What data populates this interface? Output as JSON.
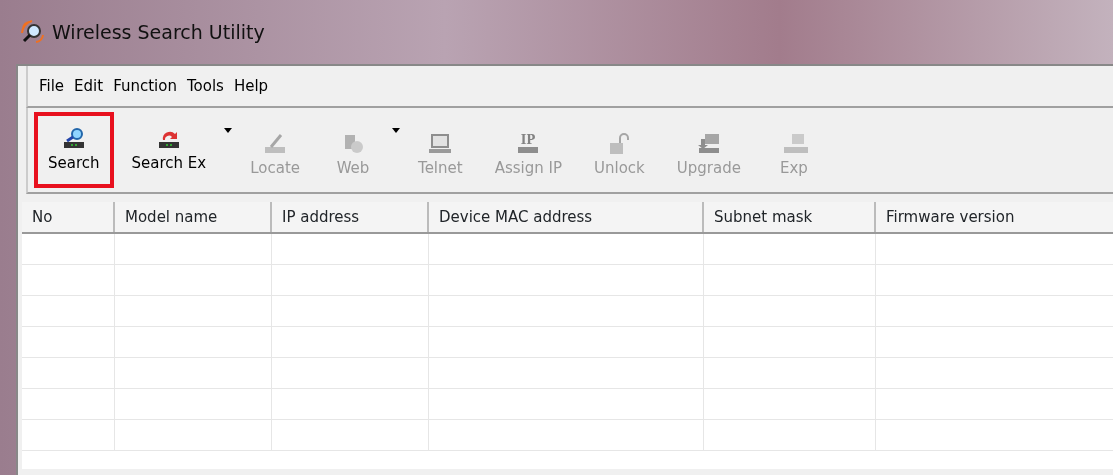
{
  "window": {
    "title": "Wireless Search Utility"
  },
  "menu": [
    "File",
    "Edit",
    "Function",
    "Tools",
    "Help"
  ],
  "toolbar": [
    {
      "label": "Search",
      "disabled": false,
      "dropdown": false,
      "highlighted": true,
      "kind": "search"
    },
    {
      "label": "Search Ex",
      "disabled": false,
      "dropdown": true,
      "highlighted": false,
      "kind": "search-ex"
    },
    {
      "label": "Locate",
      "disabled": true,
      "dropdown": false,
      "highlighted": false,
      "kind": "locate"
    },
    {
      "label": "Web",
      "disabled": true,
      "dropdown": true,
      "highlighted": false,
      "kind": "web"
    },
    {
      "label": "Telnet",
      "disabled": true,
      "dropdown": false,
      "highlighted": false,
      "kind": "telnet"
    },
    {
      "label": "Assign IP",
      "disabled": true,
      "dropdown": false,
      "highlighted": false,
      "kind": "ip",
      "icon_text": "IP"
    },
    {
      "label": "Unlock",
      "disabled": true,
      "dropdown": false,
      "highlighted": false,
      "kind": "unlock"
    },
    {
      "label": "Upgrade",
      "disabled": true,
      "dropdown": false,
      "highlighted": false,
      "kind": "upgrade"
    },
    {
      "label": "Exp",
      "disabled": true,
      "dropdown": false,
      "highlighted": false,
      "kind": "export"
    }
  ],
  "table": {
    "columns": [
      "No",
      "Model name",
      "IP address",
      "Device MAC address",
      "Subnet mask",
      "Firmware version"
    ]
  }
}
